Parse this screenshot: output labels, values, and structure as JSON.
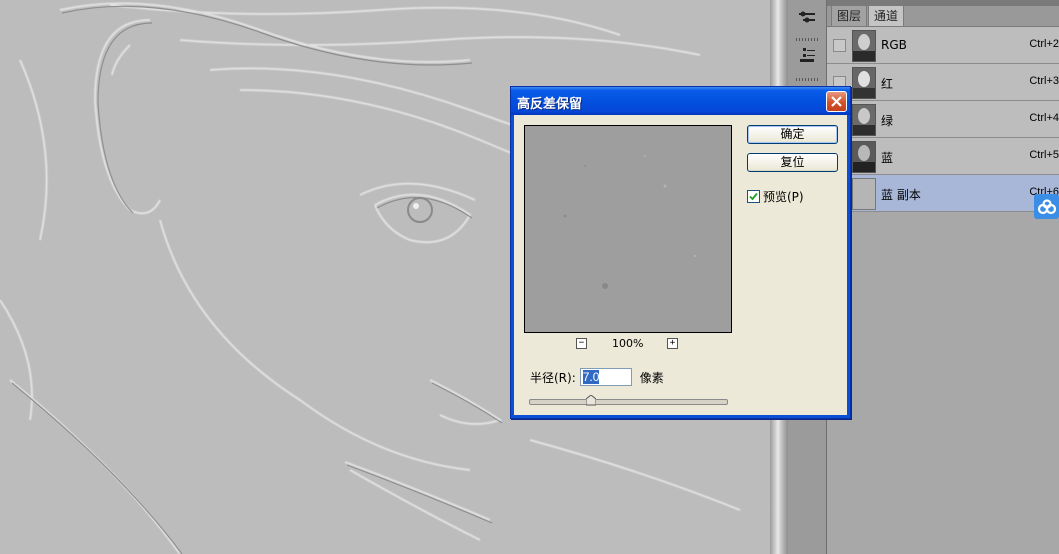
{
  "dialog": {
    "title": "高反差保留",
    "ok_label": "确定",
    "reset_label": "复位",
    "preview_label": "预览(P)",
    "preview_checked": true,
    "zoom_out": "−",
    "zoom_in": "+",
    "zoom_level": "100%",
    "radius_label": "半径(R):",
    "radius_value": "7.0",
    "radius_unit": "像素",
    "radius_slider_fraction": 0.3
  },
  "panel": {
    "tabs": [
      "图层",
      "通道"
    ],
    "active_tab": "通道",
    "channels": [
      {
        "name": "RGB",
        "shortcut": "Ctrl+2",
        "selected": false
      },
      {
        "name": "红",
        "shortcut": "Ctrl+3",
        "selected": false
      },
      {
        "name": "绿",
        "shortcut": "Ctrl+4",
        "selected": false
      },
      {
        "name": "蓝",
        "shortcut": "Ctrl+5",
        "selected": false
      },
      {
        "name": "蓝 副本",
        "shortcut": "Ctrl+6",
        "selected": true
      }
    ]
  },
  "colors": {
    "title_bar": "#0351e0",
    "selected_row": "#a8b6d8",
    "close_button": "#d3512b"
  },
  "icons": [
    "close-icon",
    "check-icon",
    "tool-brush-icon",
    "tool-stack-icon",
    "float-link-icon"
  ]
}
